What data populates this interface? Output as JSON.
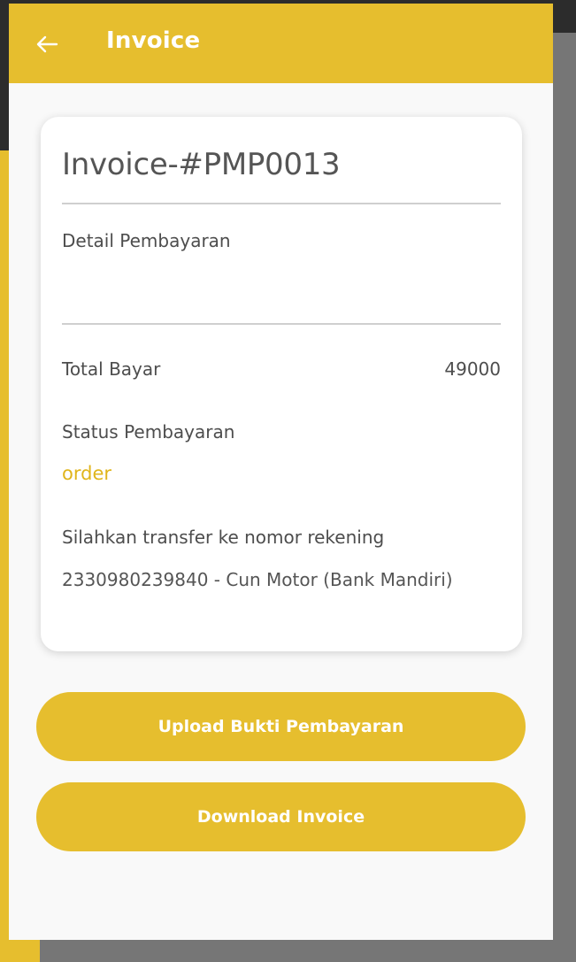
{
  "appbar": {
    "title": "Invoice",
    "back_icon": "arrow-left-icon",
    "color": "#e6be2e"
  },
  "card": {
    "invoice_number": "Invoice-#PMP0013",
    "detail_label": "Detail Pembayaran",
    "total_label": "Total Bayar",
    "total_value": "49000",
    "status_label": "Status Pembayaran",
    "status_value": "order",
    "status_color": "#e0b51c",
    "transfer_label": "Silahkan transfer ke nomor rekening",
    "account_text": "2330980239840 - Cun Motor (Bank Mandiri)"
  },
  "actions": {
    "upload_label": "Upload Bukti Pembayaran",
    "download_label": "Download Invoice"
  }
}
